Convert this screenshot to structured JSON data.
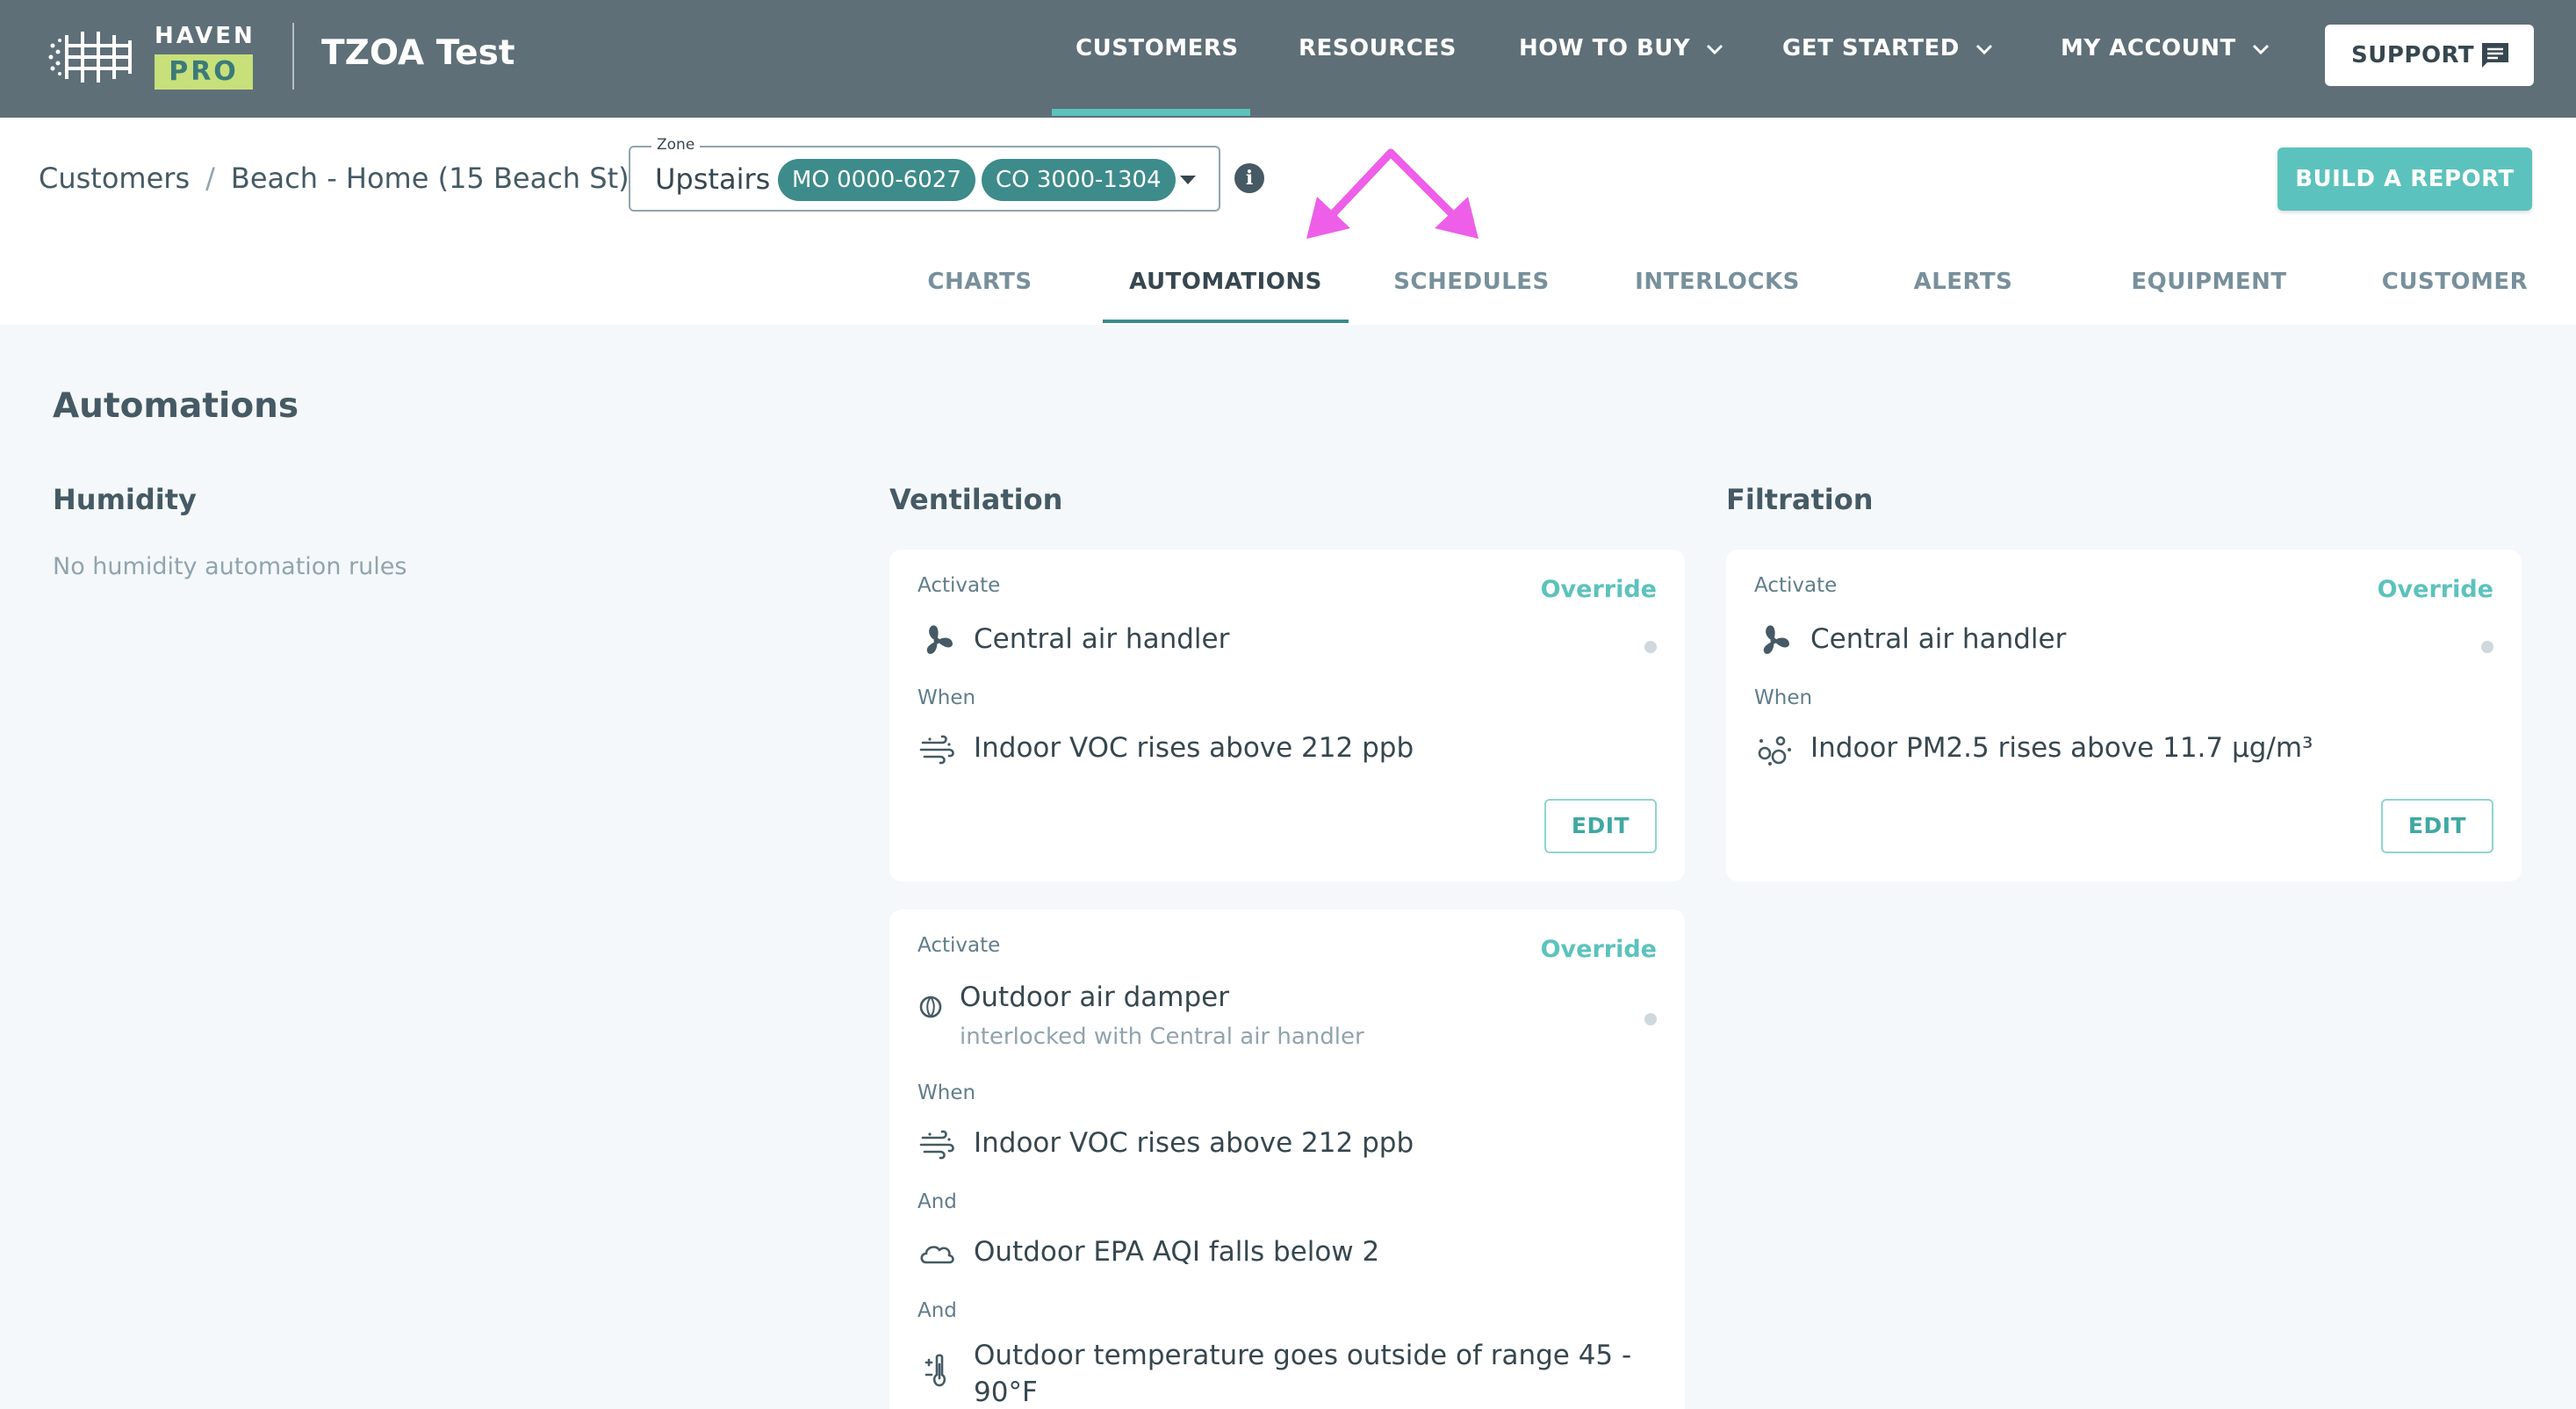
{
  "header": {
    "brand_top": "HAVEN",
    "brand_bottom": "PRO",
    "app_title": "TZOA Test",
    "nav": [
      {
        "label": "CUSTOMERS",
        "dropdown": false,
        "active": true
      },
      {
        "label": "RESOURCES",
        "dropdown": false
      },
      {
        "label": "HOW TO BUY",
        "dropdown": true
      },
      {
        "label": "GET STARTED",
        "dropdown": true
      },
      {
        "label": "MY ACCOUNT",
        "dropdown": true
      }
    ],
    "support_label": "SUPPORT"
  },
  "breadcrumb": {
    "items": [
      "Customers",
      "Beach - Home (15 Beach St)"
    ],
    "separator": "/"
  },
  "zone": {
    "label": "Zone",
    "value": "Upstairs",
    "chips": [
      "MO 0000-6027",
      "CO 3000-1304"
    ]
  },
  "build_report_label": "BUILD A REPORT",
  "tabs": [
    {
      "label": "CHARTS"
    },
    {
      "label": "AUTOMATIONS",
      "active": true
    },
    {
      "label": "SCHEDULES"
    },
    {
      "label": "INTERLOCKS"
    },
    {
      "label": "ALERTS"
    },
    {
      "label": "EQUIPMENT"
    },
    {
      "label": "CUSTOMER"
    }
  ],
  "page": {
    "title": "Automations",
    "columns": {
      "humidity": {
        "title": "Humidity",
        "empty": "No humidity automation rules"
      },
      "ventilation": {
        "title": "Ventilation"
      },
      "filtration": {
        "title": "Filtration"
      }
    }
  },
  "cards": {
    "vent1": {
      "activate": "Activate",
      "override": "Override",
      "equipment": "Central air handler",
      "when": "When",
      "condition": "Indoor VOC rises above 212 ppb",
      "edit": "EDIT"
    },
    "filt1": {
      "activate": "Activate",
      "override": "Override",
      "equipment": "Central air handler",
      "when": "When",
      "condition": "Indoor PM2.5 rises above 11.7 μg/m³",
      "edit": "EDIT"
    },
    "vent2": {
      "activate": "Activate",
      "override": "Override",
      "equipment": "Outdoor air damper",
      "equipment_sub": "interlocked with Central air handler",
      "when": "When",
      "condition1": "Indoor VOC rises above 212 ppb",
      "and1": "And",
      "condition2": "Outdoor EPA AQI falls below 2",
      "and2": "And",
      "condition3_line1": "Outdoor temperature goes outside of range 45 -",
      "condition3_line2": "90°F"
    }
  },
  "colors": {
    "topbar": "#5f6f78",
    "accent": "#5cc2bd",
    "chip": "#3d8b8a",
    "annotation_arrow": "#ee5ee8"
  }
}
